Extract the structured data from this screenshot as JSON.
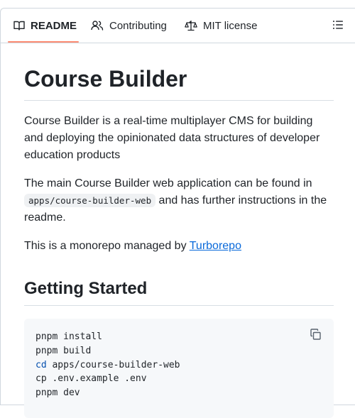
{
  "tabs": [
    {
      "label": "README",
      "icon": "book-icon",
      "active": true
    },
    {
      "label": "Contributing",
      "icon": "people-icon",
      "active": false
    },
    {
      "label": "MIT license",
      "icon": "law-scale-icon",
      "active": false
    }
  ],
  "outline_icon": "list-unordered-icon",
  "readme": {
    "title": "Course Builder",
    "intro": "Course Builder is a real-time multiplayer CMS for building and deploying the opinionated data structures of developer education products",
    "main_app_before": "The main Course Builder web application can be found in",
    "main_app_code": "apps/course-builder-web",
    "main_app_after": " and has further instructions in the readme.",
    "monorepo_before": "This is a monorepo managed by ",
    "monorepo_link": "Turborepo",
    "getting_started": "Getting Started",
    "code_lines": [
      {
        "keyword": "",
        "text": "pnpm install"
      },
      {
        "keyword": "",
        "text": "pnpm build"
      },
      {
        "keyword": "cd",
        "text": " apps/course-builder-web"
      },
      {
        "keyword": "",
        "text": "cp .env.example .env"
      },
      {
        "keyword": "",
        "text": "pnpm dev"
      }
    ],
    "copy_icon": "copy-icon"
  },
  "colors": {
    "active_tab_underline": "#fd8c73",
    "link": "#0969da",
    "keyword": "#0550ae"
  }
}
